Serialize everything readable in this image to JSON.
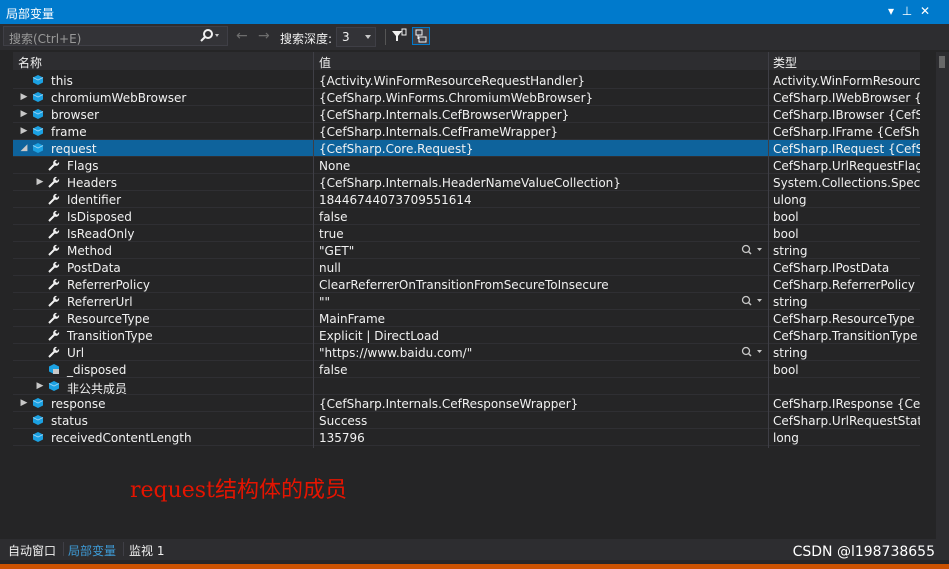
{
  "window": {
    "title": "局部变量"
  },
  "toolbar": {
    "search_placeholder": "搜索(Ctrl+E)",
    "depth_label": "搜索深度:",
    "depth_value": "3"
  },
  "columns": {
    "name": "名称",
    "value": "值",
    "type": "类型"
  },
  "rows": [
    {
      "name": "this",
      "value": "{Activity.WinFormResourceRequestHandler}",
      "type": "Activity.WinFormResourc...",
      "indent": 0,
      "expander": "",
      "icon": "object-icon"
    },
    {
      "name": "chromiumWebBrowser",
      "value": "{CefSharp.WinForms.ChromiumWebBrowser}",
      "type": "CefSharp.IWebBrowser {C...",
      "indent": 0,
      "expander": "▶",
      "icon": "object-icon"
    },
    {
      "name": "browser",
      "value": "{CefSharp.Internals.CefBrowserWrapper}",
      "type": "CefSharp.IBrowser {CefSh...",
      "indent": 0,
      "expander": "▶",
      "icon": "object-icon"
    },
    {
      "name": "frame",
      "value": "{CefSharp.Internals.CefFrameWrapper}",
      "type": "CefSharp.IFrame {CefShar...",
      "indent": 0,
      "expander": "▶",
      "icon": "object-icon"
    },
    {
      "name": "request",
      "value": "{CefSharp.Core.Request}",
      "type": "CefSharp.IRequest {CefSh...",
      "indent": 0,
      "expander": "◢",
      "icon": "object-icon",
      "selected": true
    },
    {
      "name": "Flags",
      "value": "None",
      "type": "CefSharp.UrlRequestFlags",
      "indent": 1,
      "expander": "",
      "icon": "wrench-icon"
    },
    {
      "name": "Headers",
      "value": "{CefSharp.Internals.HeaderNameValueCollection}",
      "type": "System.Collections.Specia...",
      "indent": 1,
      "expander": "▶",
      "icon": "wrench-icon"
    },
    {
      "name": "Identifier",
      "value": "18446744073709551614",
      "type": "ulong",
      "indent": 1,
      "expander": "",
      "icon": "wrench-icon"
    },
    {
      "name": "IsDisposed",
      "value": "false",
      "type": "bool",
      "indent": 1,
      "expander": "",
      "icon": "wrench-icon"
    },
    {
      "name": "IsReadOnly",
      "value": "true",
      "type": "bool",
      "indent": 1,
      "expander": "",
      "icon": "wrench-icon"
    },
    {
      "name": "Method",
      "value": "\"GET\"",
      "type": "string",
      "indent": 1,
      "expander": "",
      "icon": "wrench-icon",
      "magnifier": true
    },
    {
      "name": "PostData",
      "value": "null",
      "type": "CefSharp.IPostData",
      "indent": 1,
      "expander": "",
      "icon": "wrench-icon"
    },
    {
      "name": "ReferrerPolicy",
      "value": "ClearReferrerOnTransitionFromSecureToInsecure",
      "type": "CefSharp.ReferrerPolicy",
      "indent": 1,
      "expander": "",
      "icon": "wrench-icon"
    },
    {
      "name": "ReferrerUrl",
      "value": "\"\"",
      "type": "string",
      "indent": 1,
      "expander": "",
      "icon": "wrench-icon",
      "magnifier": true
    },
    {
      "name": "ResourceType",
      "value": "MainFrame",
      "type": "CefSharp.ResourceType",
      "indent": 1,
      "expander": "",
      "icon": "wrench-icon"
    },
    {
      "name": "TransitionType",
      "value": "Explicit | DirectLoad",
      "type": "CefSharp.TransitionType",
      "indent": 1,
      "expander": "",
      "icon": "wrench-icon"
    },
    {
      "name": "Url",
      "value": "\"https://www.baidu.com/\"",
      "type": "string",
      "indent": 1,
      "expander": "",
      "icon": "wrench-icon",
      "magnifier": true
    },
    {
      "name": "_disposed",
      "value": "false",
      "type": "bool",
      "indent": 1,
      "expander": "",
      "icon": "private-field-icon"
    },
    {
      "name": "非公共成员",
      "value": "",
      "type": "",
      "indent": 1,
      "expander": "▶",
      "icon": "object-icon"
    },
    {
      "name": "response",
      "value": "{CefSharp.Internals.CefResponseWrapper}",
      "type": "CefSharp.IResponse {CefS...",
      "indent": 0,
      "expander": "▶",
      "icon": "object-icon"
    },
    {
      "name": "status",
      "value": "Success",
      "type": "CefSharp.UrlRequestStatus",
      "indent": 0,
      "expander": "",
      "icon": "object-icon"
    },
    {
      "name": "receivedContentLength",
      "value": "135796",
      "type": "long",
      "indent": 0,
      "expander": "",
      "icon": "object-icon"
    }
  ],
  "annotation": "request结构体的成员",
  "bottom_tabs": [
    {
      "label": "自动窗口",
      "active": false
    },
    {
      "label": "局部变量",
      "active": true
    },
    {
      "label": "监视 1",
      "active": false
    }
  ],
  "watermark": "CSDN @l198738655",
  "colors": {
    "accent": "#007acc",
    "selected_row": "#0e639c",
    "annotation": "#e51400",
    "active_tab": "#3e9bd6"
  }
}
